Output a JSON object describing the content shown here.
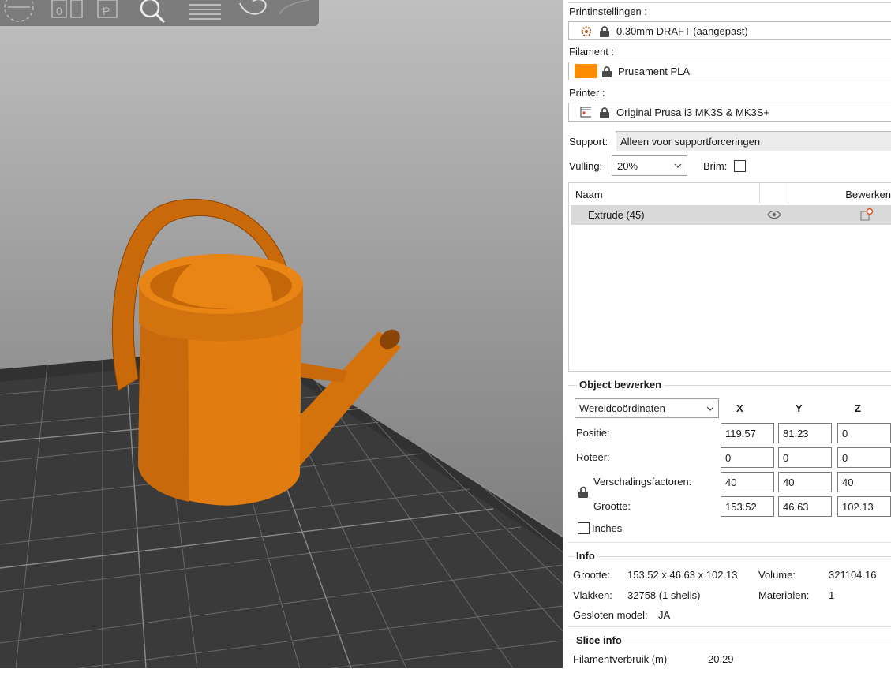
{
  "toolbar": {
    "icons": [
      "layers-circle-icon",
      "arrange-icon",
      "place-on-face-icon",
      "search-icon",
      "settings-list-icon",
      "undo-icon",
      "redo-icon"
    ]
  },
  "model": {
    "color": "#E07C10"
  },
  "sidebar": {
    "print_settings_label": "Printinstellingen :",
    "print_settings_value": "0.30mm DRAFT (aangepast)",
    "filament_label": "Filament :",
    "filament_value": "Prusament PLA",
    "filament_color": "#FF8C00",
    "printer_label": "Printer :",
    "printer_value": "Original Prusa i3 MK3S & MK3S+",
    "support_label": "Support:",
    "support_value": "Alleen voor supportforceringen",
    "infill_label": "Vulling:",
    "infill_value": "20%",
    "brim_label": "Brim:",
    "object_list": {
      "col_name": "Naam",
      "col_edit": "Bewerken",
      "items": [
        {
          "name": "Extrude (45)"
        }
      ]
    },
    "object_edit": {
      "title": "Object bewerken",
      "coord_system": "Wereldcoördinaten",
      "axes": [
        "X",
        "Y",
        "Z"
      ],
      "rows": [
        {
          "label": "Positie:",
          "values": [
            "119.57",
            "81.23",
            "0"
          ]
        },
        {
          "label": "Roteer:",
          "values": [
            "0",
            "0",
            "0"
          ]
        },
        {
          "label": "Verschalingsfactoren:",
          "values": [
            "40",
            "40",
            "40"
          ]
        },
        {
          "label": "Grootte:",
          "values": [
            "153.52",
            "46.63",
            "102.13"
          ]
        }
      ],
      "inches_label": "Inches"
    },
    "info": {
      "title": "Info",
      "size_label": "Grootte:",
      "size_value": "153.52 x 46.63 x 102.13",
      "volume_label": "Volume:",
      "volume_value": "321104.16",
      "facets_label": "Vlakken:",
      "facets_value": "32758 (1 shells)",
      "materials_label": "Materialen:",
      "materials_value": "1",
      "closed_label": "Gesloten model:",
      "closed_value": "JA"
    },
    "slice_info": {
      "title": "Slice info",
      "filament_usage_label": "Filamentverbruik (m)",
      "filament_usage_value": "20.29"
    }
  }
}
